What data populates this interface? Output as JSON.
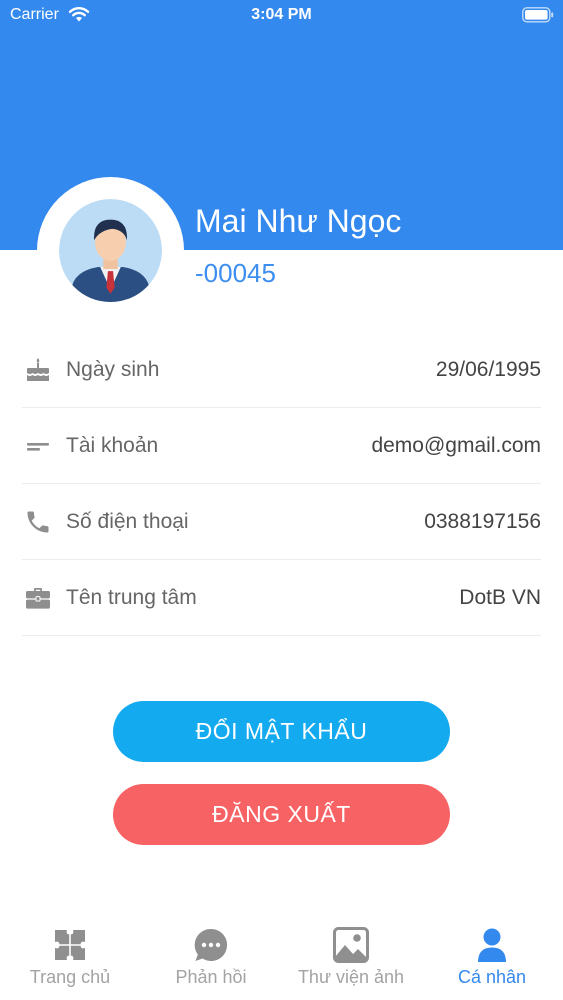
{
  "status_bar": {
    "carrier": "Carrier",
    "time": "3:04 PM"
  },
  "profile": {
    "name": "Mai Như Ngọc",
    "code": "-00045"
  },
  "info_rows": [
    {
      "icon": "birthday-cake-icon",
      "label": "Ngày sinh",
      "value": "29/06/1995"
    },
    {
      "icon": "account-lines-icon",
      "label": "Tài khoản",
      "value": "demo@gmail.com"
    },
    {
      "icon": "phone-icon",
      "label": "Số điện thoại",
      "value": "0388197156"
    },
    {
      "icon": "briefcase-icon",
      "label": "Tên trung tâm",
      "value": "DotB VN"
    }
  ],
  "buttons": {
    "change_password": "ĐỔI MẬT KHẨU",
    "logout": "ĐĂNG XUẤT"
  },
  "tabs": [
    {
      "icon": "puzzle-icon",
      "label": "Trang chủ",
      "active": false
    },
    {
      "icon": "chat-bubble-icon",
      "label": "Phản hồi",
      "active": false
    },
    {
      "icon": "image-gallery-icon",
      "label": "Thư viện ảnh",
      "active": false
    },
    {
      "icon": "person-icon",
      "label": "Cá nhân",
      "active": true
    }
  ],
  "colors": {
    "header": "#3489ee",
    "code": "#3c8ef0",
    "change_password_button": "#14aaf0",
    "logout_button": "#f76364",
    "tab_active": "#3489ee",
    "tab_inactive": "#a3a3a3"
  }
}
